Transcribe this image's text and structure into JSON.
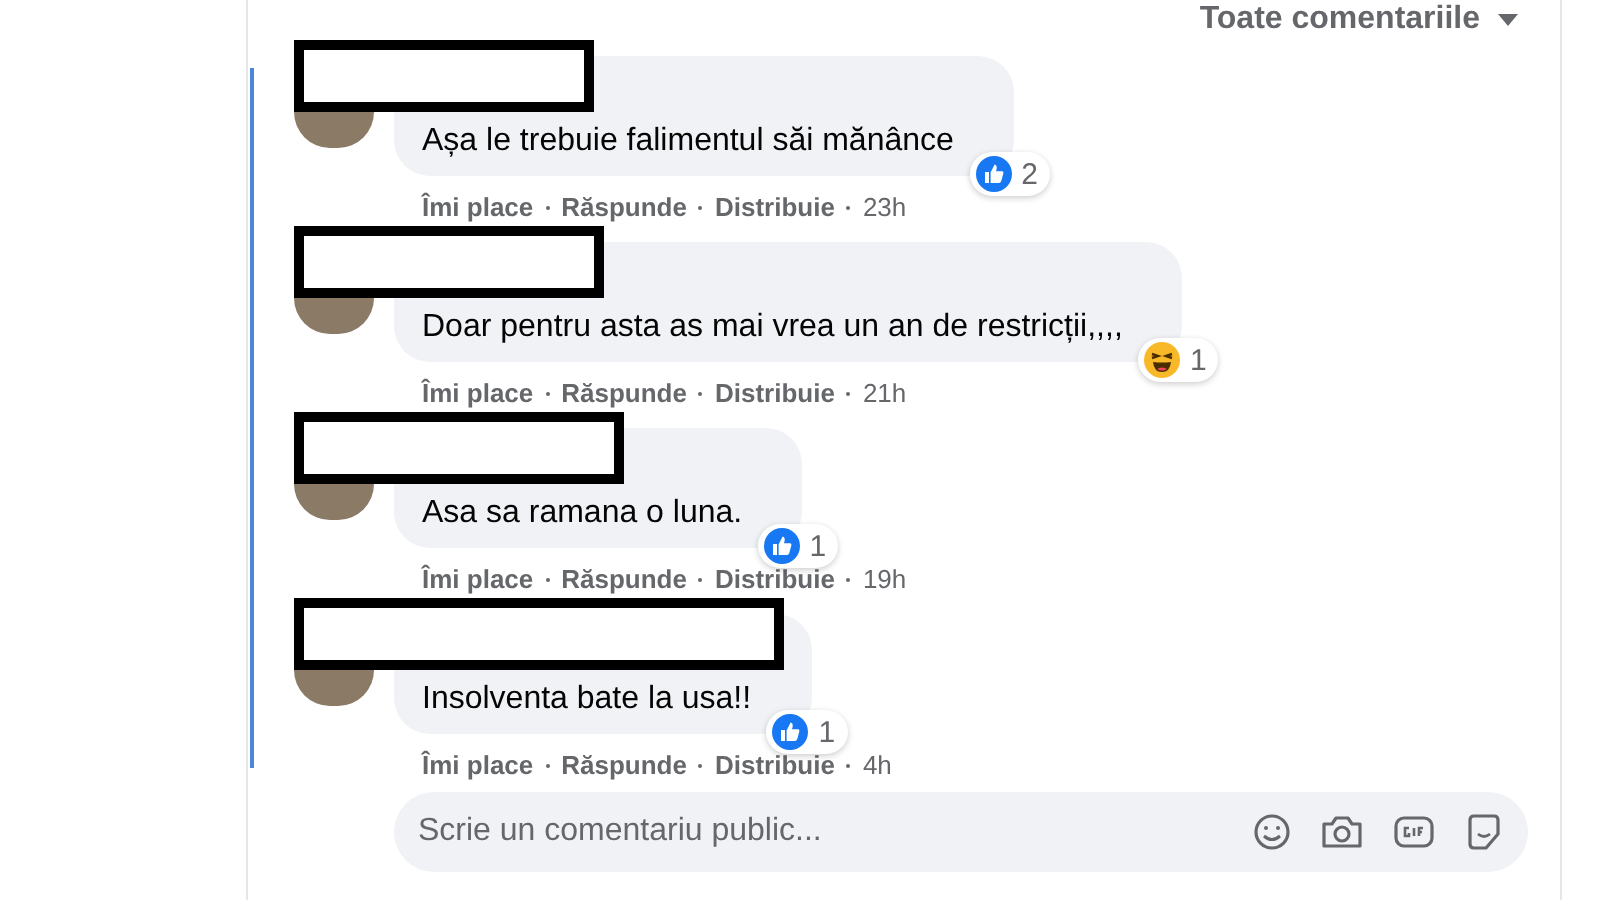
{
  "filter": {
    "label": "Toate comentariile"
  },
  "comments": [
    {
      "text": "Așa le trebuie falimentul săi mănânce",
      "reaction": {
        "kind": "like",
        "count": "2"
      },
      "actions": [
        "Îmi place",
        "Răspunde",
        "Distribuie"
      ],
      "time": "23h"
    },
    {
      "text": "Doar pentru asta as mai vrea un an de restricții,,,,",
      "reaction": {
        "kind": "haha",
        "count": "1"
      },
      "actions": [
        "Îmi place",
        "Răspunde",
        "Distribuie"
      ],
      "time": "21h"
    },
    {
      "text": "Asa sa ramana o luna.",
      "reaction": {
        "kind": "like",
        "count": "1"
      },
      "actions": [
        "Îmi place",
        "Răspunde",
        "Distribuie"
      ],
      "time": "19h"
    },
    {
      "text": "Insolventa bate la usa!!",
      "reaction": {
        "kind": "like",
        "count": "1"
      },
      "actions": [
        "Îmi place",
        "Răspunde",
        "Distribuie"
      ],
      "time": "4h"
    }
  ],
  "composer": {
    "placeholder": "Scrie un comentariu public..."
  }
}
